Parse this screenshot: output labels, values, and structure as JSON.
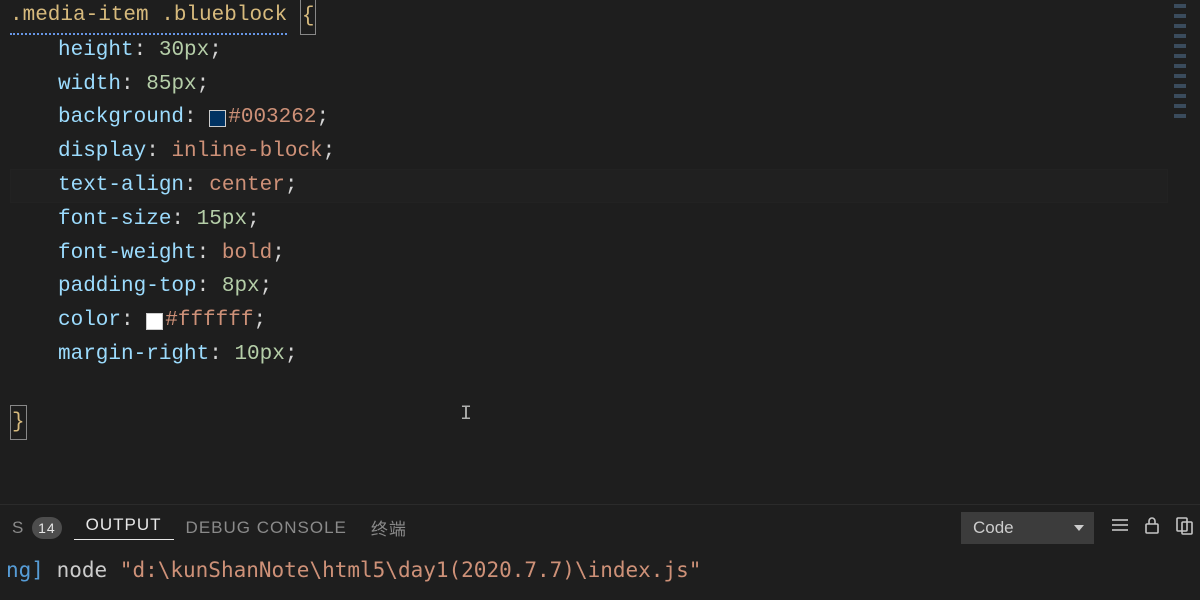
{
  "editor": {
    "selector_text": ".media-item .blueblock",
    "open_brace": "{",
    "close_brace": "}",
    "decls": [
      {
        "prop": "height",
        "value": "30px",
        "kind": "num"
      },
      {
        "prop": "width",
        "value": "85px",
        "kind": "num"
      },
      {
        "prop": "background",
        "value": "#003262",
        "kind": "color",
        "swatch": "#003262"
      },
      {
        "prop": "display",
        "value": "inline-block",
        "kind": "kw"
      },
      {
        "prop": "text-align",
        "value": "center",
        "kind": "kw"
      },
      {
        "prop": "font-size",
        "value": "15px",
        "kind": "num"
      },
      {
        "prop": "font-weight",
        "value": "bold",
        "kind": "kw"
      },
      {
        "prop": "padding-top",
        "value": "8px",
        "kind": "num"
      },
      {
        "prop": "color",
        "value": "#ffffff",
        "kind": "color",
        "swatch": "#ffffff"
      },
      {
        "prop": "margin-right",
        "value": "10px",
        "kind": "num"
      }
    ],
    "current_line_index": 4
  },
  "panel": {
    "tab_s_label": "S",
    "tab_s_badge": "14",
    "tab_output": "OUTPUT",
    "tab_debug": "DEBUG CONSOLE",
    "tab_terminal": "终端",
    "dropdown_value": "Code"
  },
  "terminal": {
    "prefix_tag": "ng]",
    "cmd_plain": " node ",
    "cmd_path": "\"d:\\kunShanNote\\html5\\day1(2020.7.7)\\index.js\""
  }
}
